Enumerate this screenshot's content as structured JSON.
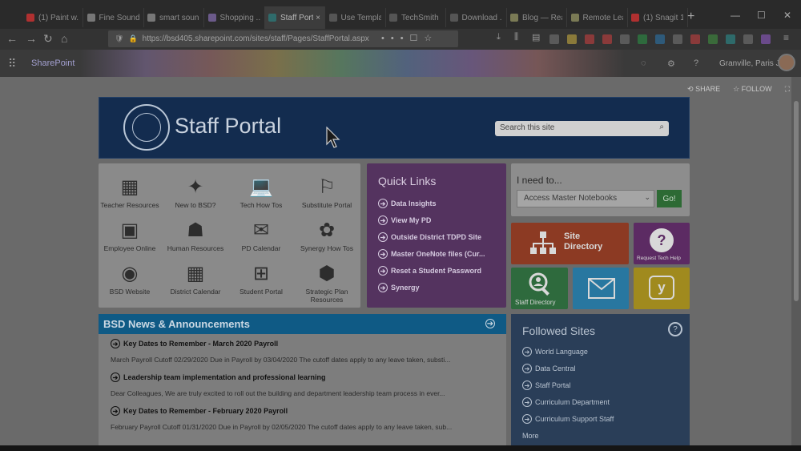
{
  "browser": {
    "tabs": [
      {
        "label": "(1) Paint w...",
        "color": "#b03030"
      },
      {
        "label": "Fine Sound...",
        "color": "#777777"
      },
      {
        "label": "smart sound",
        "color": "#777777"
      },
      {
        "label": "Shopping ...",
        "color": "#6b5a8a"
      },
      {
        "label": "Staff Port...",
        "color": "#2f6b6b",
        "active": true
      },
      {
        "label": "Use Templat...",
        "color": "#555555"
      },
      {
        "label": "TechSmith ...",
        "color": "#555555"
      },
      {
        "label": "Download ...",
        "color": "#555555"
      },
      {
        "label": "Blog — Rea...",
        "color": "#7a7a55"
      },
      {
        "label": "Remote Lea...",
        "color": "#7a7a55"
      },
      {
        "label": "(1) Snagit 1...",
        "color": "#b03030"
      }
    ],
    "url": "https://bsd405.sharepoint.com/sites/staff/Pages/StaffPortal.aspx",
    "new_tab": "+",
    "close_glyph": "×"
  },
  "suite": {
    "brand": "SharePoint",
    "user": "Granville, Paris J"
  },
  "actions": {
    "share": "SHARE",
    "follow": "FOLLOW"
  },
  "banner": {
    "title": "Staff Portal",
    "search_placeholder": "Search this site"
  },
  "grid": [
    {
      "label": "Teacher Resources",
      "icon": "teacher-resources-icon"
    },
    {
      "label": "New to BSD?",
      "icon": "compass-icon"
    },
    {
      "label": "Tech How Tos",
      "icon": "laptop-icon"
    },
    {
      "label": "Substitute Portal",
      "icon": "substitute-icon"
    },
    {
      "label": "Employee Online",
      "icon": "employee-card-icon"
    },
    {
      "label": "Human Resources",
      "icon": "people-icon"
    },
    {
      "label": "PD Calendar",
      "icon": "certificate-icon"
    },
    {
      "label": "Synergy How Tos",
      "icon": "synergy-icon"
    },
    {
      "label": "BSD Website",
      "icon": "district-seal-icon"
    },
    {
      "label": "District Calendar",
      "icon": "calendar-icon"
    },
    {
      "label": "Student Portal",
      "icon": "windows-icon"
    },
    {
      "label": "Strategic Plan Resources",
      "icon": "hexagon-icon"
    }
  ],
  "quick_links": {
    "title": "Quick Links",
    "items": [
      "Data Insights",
      "View My PD",
      "Outside District TDPD Site",
      "Master OneNote files (Cur...",
      "Reset a Student Password",
      "Synergy"
    ]
  },
  "need_to": {
    "label": "I need to...",
    "selected": "Access Master Notebooks",
    "go": "Go!"
  },
  "tiles": {
    "site_directory": "Site Directory",
    "tech_help": "Request Tech Help",
    "staff_directory": "Staff Directory"
  },
  "news": {
    "title": "BSD News & Announcements",
    "items": [
      {
        "title": "Key Dates to Remember - March 2020 Payroll",
        "summary": "March Payroll Cutoff 02/29/2020 Due in Payroll by 03/04/2020 The cutoff dates apply to any leave taken, substi..."
      },
      {
        "title": "Leadership team implementation and professional learning",
        "summary": "Dear Colleagues, We are truly excited to roll out the building and department leadership team process in ever..."
      },
      {
        "title": "Key Dates to Remember - February 2020 Payroll",
        "summary": "February Payroll Cutoff 01/31/2020 Due in Payroll by 02/05/2020 The cutoff dates apply to any leave taken, sub..."
      }
    ]
  },
  "followed": {
    "title": "Followed Sites",
    "items": [
      "World Language",
      "Data Central",
      "Staff Portal",
      "Curriculum Department",
      "Curriculum Support Staff"
    ],
    "more": "More"
  },
  "colors": {
    "banner": "#132c4f",
    "quick_links": "#54335f",
    "news_header": "#0f5a85",
    "site_directory": "#8c3a23",
    "tech_help": "#5c2b63",
    "staff_directory": "#2e6a3d",
    "mail": "#2877a0",
    "yammer": "#a08a1e",
    "followed": "#2a3e58"
  }
}
